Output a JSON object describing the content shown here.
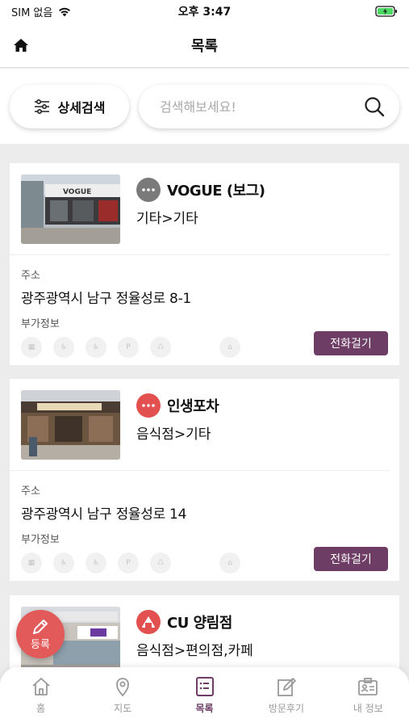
{
  "status_bar": {
    "carrier": "SIM 없음",
    "time": "오후 3:47"
  },
  "header": {
    "title": "목록"
  },
  "search": {
    "filter_label": "상세검색",
    "placeholder": "검색해보세요!"
  },
  "places": [
    {
      "name": "VOGUE (보그)",
      "category": "기타>기타",
      "address_label": "주소",
      "address": "광주광역시 남구 정율성로 8-1",
      "extra_label": "부가정보",
      "call_label": "전화걸기",
      "category_icon": "more-dots-icon",
      "icon_color": "#7a7a7a"
    },
    {
      "name": "인생포차",
      "category": "음식점>기타",
      "address_label": "주소",
      "address": "광주광역시 남구 정율성로 14",
      "extra_label": "부가정보",
      "call_label": "전화걸기",
      "category_icon": "more-dots-icon",
      "icon_color": "#e25050"
    },
    {
      "name": "CU 양림점",
      "category": "음식점>편의점,카페",
      "category_icon": "rice-ball-icon",
      "icon_color": "#e25050"
    }
  ],
  "fab": {
    "label": "등록"
  },
  "bottom_nav": [
    {
      "label": "홈",
      "icon": "home-icon",
      "active": false
    },
    {
      "label": "지도",
      "icon": "map-pin-icon",
      "active": false
    },
    {
      "label": "목록",
      "icon": "list-icon",
      "active": true
    },
    {
      "label": "방문후기",
      "icon": "review-icon",
      "active": false
    },
    {
      "label": "내 정보",
      "icon": "profile-card-icon",
      "active": false
    }
  ],
  "colors": {
    "accent": "#6e3d66",
    "fab": "#e25a5a",
    "background": "#ececec"
  }
}
